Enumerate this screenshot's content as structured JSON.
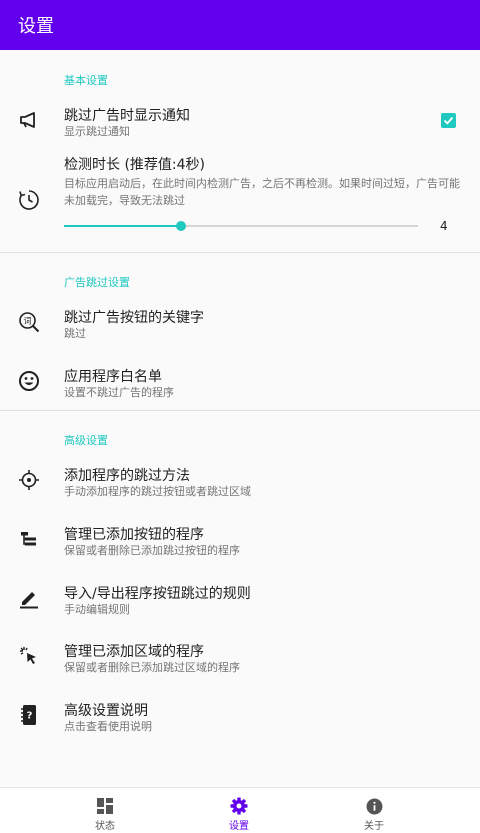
{
  "appbar": {
    "title": "设置"
  },
  "colors": {
    "primary": "#6200ee",
    "accent": "#1fc9c0"
  },
  "sections": {
    "basic": {
      "header": "基本设置",
      "skip_notify": {
        "title": "跳过广告时显示通知",
        "summary": "显示跳过通知",
        "icon": "megaphone-icon",
        "checked": true
      },
      "duration": {
        "title": "检测时长 (推荐值:4秒)",
        "summary": "目标应用启动后，在此时间内检测广告，之后不再检测。如果时间过短，广告可能未加载完，导致无法跳过",
        "icon": "timer-icon",
        "value": "4",
        "fill_fraction": 0.33
      }
    },
    "skip": {
      "header": "广告跳过设置",
      "keywords": {
        "title": "跳过广告按钮的关键字",
        "summary": "跳过",
        "icon": "word-search-icon"
      },
      "whitelist": {
        "title": "应用程序白名单",
        "summary": "设置不跳过广告的程序",
        "icon": "smiley-icon"
      }
    },
    "advanced": {
      "header": "高级设置",
      "add_method": {
        "title": "添加程序的跳过方法",
        "summary": "手动添加程序的跳过按钮或者跳过区域",
        "icon": "crosshair-icon"
      },
      "manage_buttons": {
        "title": "管理已添加按钮的程序",
        "summary": "保留或者删除已添加跳过按钮的程序",
        "icon": "tree-icon"
      },
      "import_export": {
        "title": "导入/导出程序按钮跳过的规则",
        "summary": "手动编辑规则",
        "icon": "pencil-icon"
      },
      "manage_areas": {
        "title": "管理已添加区域的程序",
        "summary": "保留或者删除已添加跳过区域的程序",
        "icon": "cursor-click-icon"
      },
      "help": {
        "title": "高级设置说明",
        "summary": "点击查看使用说明",
        "icon": "help-book-icon"
      }
    }
  },
  "bottomnav": {
    "items": [
      {
        "label": "状态",
        "icon": "dashboard-icon"
      },
      {
        "label": "设置",
        "icon": "gear-icon",
        "active": true
      },
      {
        "label": "关于",
        "icon": "info-icon"
      }
    ]
  }
}
